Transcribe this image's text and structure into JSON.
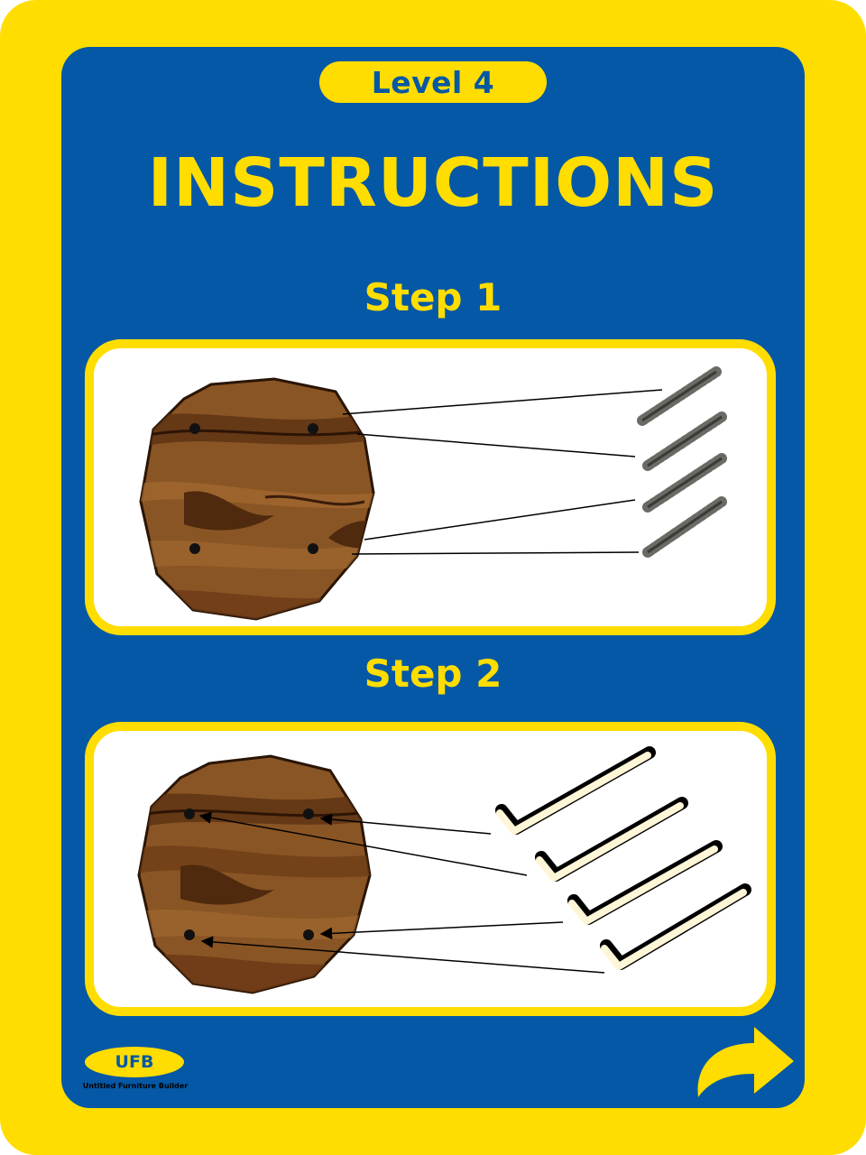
{
  "level_label": "Level 4",
  "title": "INSTRUCTIONS",
  "steps": [
    {
      "heading": "Step 1",
      "part": "screw",
      "part_count": 4,
      "hole_count": 4
    },
    {
      "heading": "Step 2",
      "part": "allen-key",
      "part_count": 4,
      "hole_count": 4
    }
  ],
  "logo": {
    "text": "UFB",
    "subtitle": "Untitled Furniture Builder"
  },
  "next_icon": "curved-arrow-right-icon",
  "colors": {
    "frame": "#ffdd00",
    "panel": "#0558a5",
    "wood": "#8a5524",
    "wood_dark": "#4f2a0e",
    "screw": "#6b6b66"
  }
}
